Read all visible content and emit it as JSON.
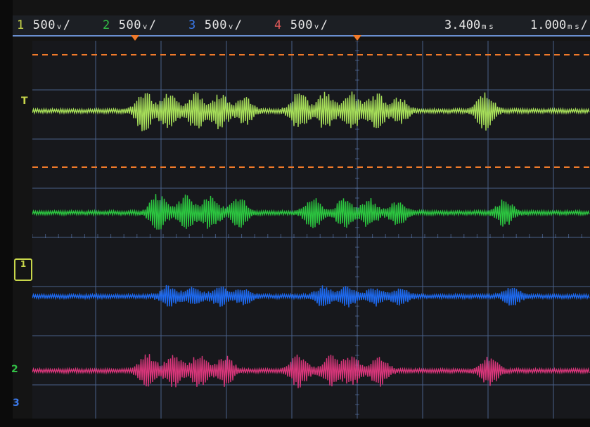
{
  "channels": [
    {
      "num": "1",
      "scale": "500ᵥ/",
      "color": "#c8d64a"
    },
    {
      "num": "2",
      "scale": "500ᵥ/",
      "color": "#32c046"
    },
    {
      "num": "3",
      "scale": "500ᵥ/",
      "color": "#3a78e8"
    },
    {
      "num": "4",
      "scale": "500ᵥ/",
      "color": "#e25a5a"
    }
  ],
  "measurements": {
    "time": "3.400ₘₛ",
    "timebase": "1.000ₘₛ/"
  },
  "markers": {
    "trigger": "T",
    "ch1_ground": "1",
    "ch2_ground": "2",
    "ch3_ground": "3"
  },
  "traces": [
    {
      "name": "ch1-trace",
      "color": "#a8e05a",
      "bursts": [
        [
          205,
          28
        ],
        [
          240,
          27
        ],
        [
          278,
          26
        ],
        [
          313,
          24
        ],
        [
          348,
          18
        ],
        [
          425,
          27
        ],
        [
          463,
          26
        ],
        [
          500,
          25
        ],
        [
          535,
          24
        ],
        [
          568,
          18
        ],
        [
          690,
          26
        ]
      ]
    },
    {
      "name": "ch2-trace",
      "color": "#2cc840",
      "bursts": [
        [
          225,
          26
        ],
        [
          265,
          24
        ],
        [
          300,
          24
        ],
        [
          340,
          20
        ],
        [
          445,
          21
        ],
        [
          490,
          20
        ],
        [
          525,
          19
        ],
        [
          566,
          16
        ],
        [
          718,
          18
        ]
      ]
    },
    {
      "name": "ch3-trace",
      "color": "#1e6af0",
      "bursts": [
        [
          240,
          14
        ],
        [
          275,
          12
        ],
        [
          313,
          12
        ],
        [
          346,
          10
        ],
        [
          460,
          14
        ],
        [
          495,
          13
        ],
        [
          534,
          12
        ],
        [
          569,
          10
        ],
        [
          728,
          12
        ]
      ]
    },
    {
      "name": "ch4-trace",
      "color": "#d8367a",
      "bursts": [
        [
          210,
          22
        ],
        [
          247,
          22
        ],
        [
          283,
          22
        ],
        [
          320,
          20
        ],
        [
          425,
          22
        ],
        [
          470,
          21
        ],
        [
          500,
          20
        ],
        [
          540,
          20
        ],
        [
          696,
          20
        ]
      ]
    }
  ]
}
